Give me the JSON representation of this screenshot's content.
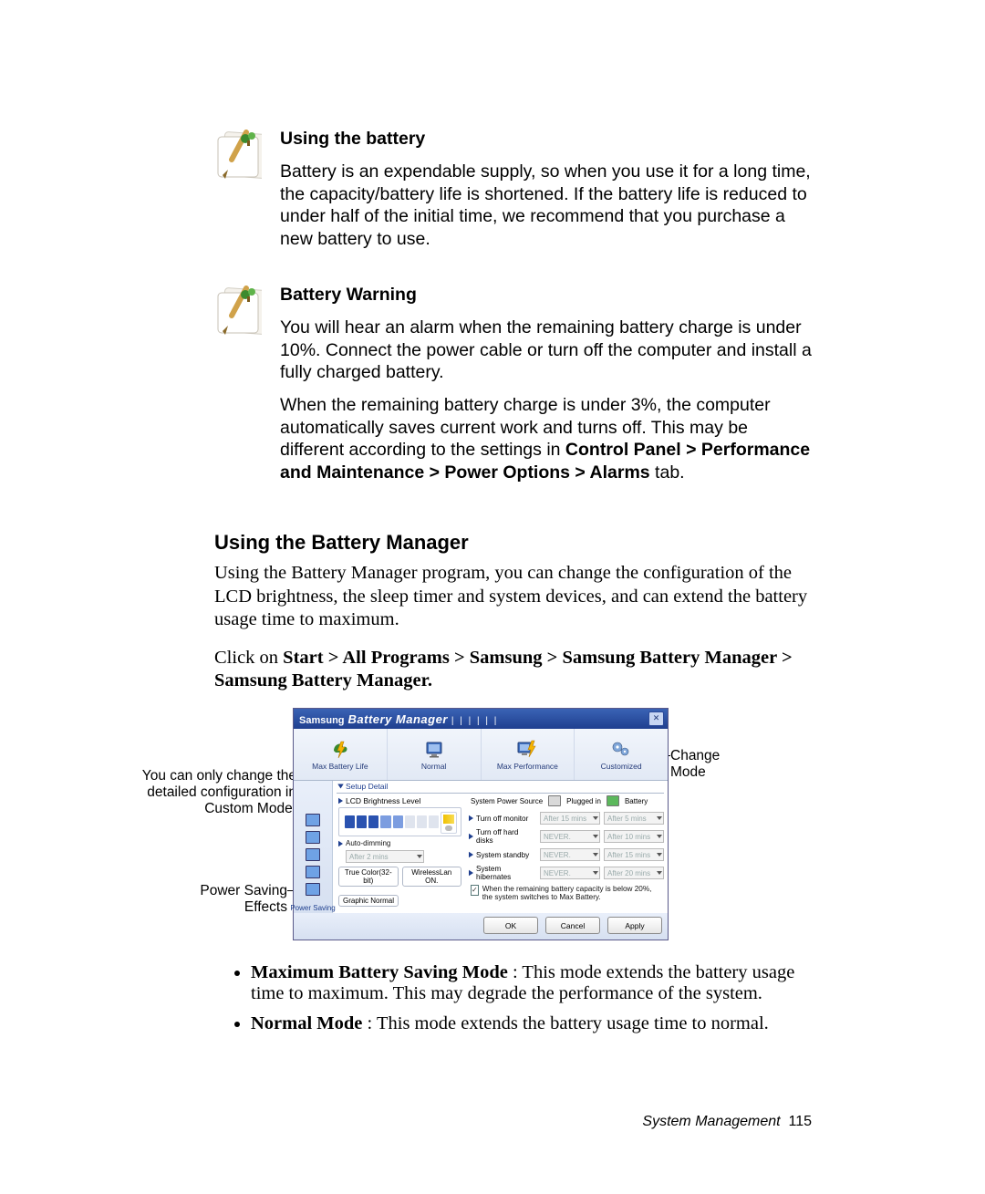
{
  "notes": [
    {
      "title": "Using the battery",
      "paragraphs": [
        "Battery is an expendable supply, so when you use it for a long time, the capacity/battery life is shortened. If the battery life is reduced to under half of the initial time, we recommend that you purchase a new battery to use."
      ]
    },
    {
      "title": "Battery Warning",
      "paragraphs": [
        "You will hear an alarm when the remaining battery charge is under 10%. Connect the power cable or turn off the computer and install a fully charged battery.",
        "When the remaining battery charge is under 3%, the computer automatically saves current work and turns off. This may be different according to the settings in <b>Control Panel > Performance and Maintenance > Power Options > Alarms</b> tab."
      ]
    }
  ],
  "section": {
    "heading": "Using the Battery Manager",
    "intro": "Using the Battery Manager program, you can change the configuration of the LCD brightness, the sleep timer and system devices, and can extend the battery usage time to maximum.",
    "click_prefix": "Click on ",
    "click_bold": "Start > All Programs > Samsung > Samsung Battery Manager > Samsung Battery Manager."
  },
  "annotations": {
    "change_mode": "Change Mode",
    "custom_only_l1": "You can only change the",
    "custom_only_l2": "detailed configuration in",
    "custom_only_l3": "Custom Mode.",
    "power_saving_l1": "Power Saving",
    "power_saving_l2": "Effects"
  },
  "bm": {
    "title_brand": "Samsung",
    "title_app": "Battery Manager",
    "modes": [
      {
        "label": "Max Battery Life"
      },
      {
        "label": "Normal"
      },
      {
        "label": "Max Performance"
      },
      {
        "label": "Customized"
      }
    ],
    "setup_detail": "Setup Detail",
    "lcd_heading": "LCD Brightness Level",
    "auto_dim": "Auto-dimming",
    "auto_dim_val": "After 2 mins",
    "left_btn_1": "True Color(32-bit)",
    "left_btn_2": "WirelessLan ON.",
    "graphic_normal": "Graphic Normal",
    "sidebar_label": "Power Saving",
    "sps_label": "System Power Source",
    "sps_val1": "Plugged in",
    "sps_val2": "Battery",
    "rows": [
      {
        "name": "Turn off monitor",
        "v1": "After 15 mins",
        "v2": "After 5 mins"
      },
      {
        "name": "Turn off hard disks",
        "v1": "NEVER.",
        "v2": "After 10 mins"
      },
      {
        "name": "System standby",
        "v1": "NEVER.",
        "v2": "After 15 mins"
      },
      {
        "name": "System hibernates",
        "v1": "NEVER.",
        "v2": "After 20 mins"
      }
    ],
    "checkbox_text": "When the remaining battery capacity is below 20%, the system switches to Max Battery.",
    "buttons": {
      "ok": "OK",
      "cancel": "Cancel",
      "apply": "Apply"
    }
  },
  "modes_list": [
    {
      "name": "Maximum Battery Saving Mode",
      "desc": " : This mode extends the battery usage time to maximum. This may degrade the performance of the system."
    },
    {
      "name": "Normal Mode",
      "desc": " : This mode extends the battery usage time to normal."
    }
  ],
  "footer": {
    "section": "System Management",
    "page": "115"
  }
}
